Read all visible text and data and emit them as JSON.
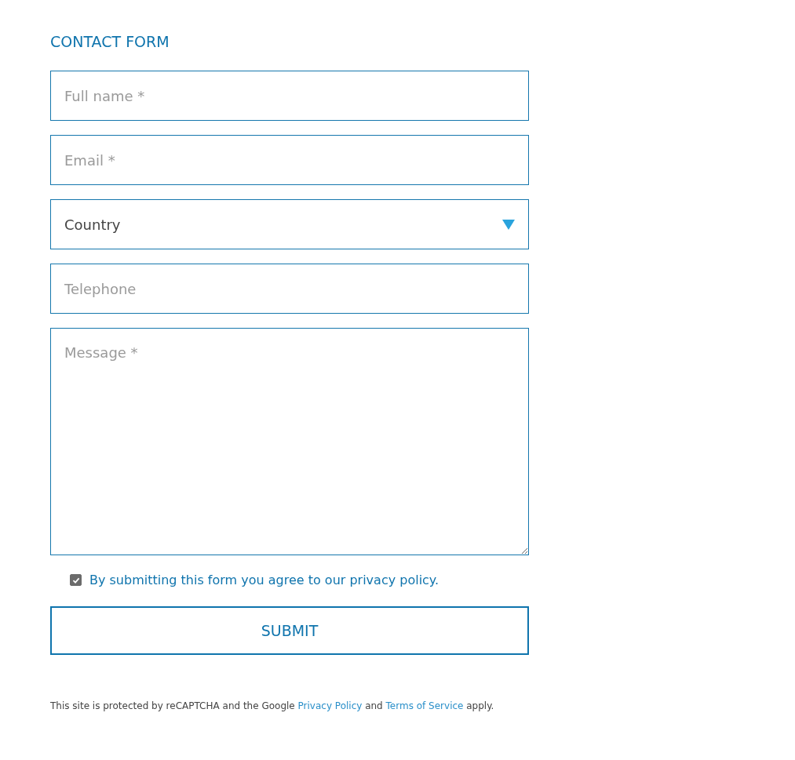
{
  "title": "CONTACT FORM",
  "fields": [
    {
      "kind": "text",
      "placeholder": "Full name *"
    },
    {
      "kind": "text",
      "placeholder": "Email *"
    },
    {
      "kind": "select",
      "value": "Country"
    },
    {
      "kind": "text",
      "placeholder": "Telephone"
    },
    {
      "kind": "textarea",
      "placeholder": "Message *"
    }
  ],
  "consent": {
    "checked": true,
    "label": "By submitting this form you agree to our privacy policy."
  },
  "submit": "SUBMIT",
  "notice": [
    {
      "kind": "text",
      "text": "This site is protected by reCAPTCHA and the Google "
    },
    {
      "kind": "link",
      "text": "Privacy Policy"
    },
    {
      "kind": "text",
      "text": " and "
    },
    {
      "kind": "link",
      "text": "Terms of Service"
    },
    {
      "kind": "text",
      "text": " apply."
    }
  ]
}
